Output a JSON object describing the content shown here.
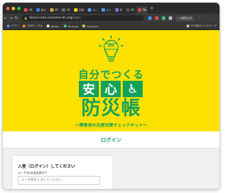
{
  "browser": {
    "tabs": [
      {
        "label": "AR",
        "color": "#e04a4a"
      },
      {
        "label": "安心",
        "color": "#3a7be0"
      },
      {
        "label": "AR",
        "color": "#e0a22a"
      },
      {
        "label": "AR",
        "color": "#6a6a6a"
      },
      {
        "label": "令和",
        "color": "#f0d020"
      },
      {
        "label": "ユー",
        "color": "#4a9ef0"
      },
      {
        "label": "ユー",
        "color": "#4a9ef0"
      },
      {
        "label": "作",
        "color": "#8a6ad0"
      },
      {
        "label": "AR",
        "color": "#555555"
      },
      {
        "label": "Rb",
        "color": "#d04a4a",
        "active": true
      }
    ],
    "add_tab": "+",
    "url": {
      "host": "bosai-note.inclusive-dn.org",
      "path": "/login"
    },
    "profile_label": "一時停止中",
    "bookmarks": [
      {
        "label": "アプリ",
        "color": "#5a8ae0"
      },
      {
        "label": "大学ポータル",
        "color": "#e08a3a"
      },
      {
        "label": "Notion",
        "color": "#dddddd"
      },
      {
        "label": "Portfolio",
        "color": "#4ac08a"
      },
      {
        "label": "Research",
        "color": "#e0c04a"
      }
    ],
    "bookmarks_right": "その他のブックマーク"
  },
  "hero": {
    "bulb_badge": "防災",
    "subtitle": "自分でつくる",
    "boxes": [
      "安",
      "心",
      "♿"
    ],
    "title": "防災帳",
    "tagline": "〜障害者の災害対策チェックキット〜",
    "colors": {
      "background": "#fde100",
      "green": "#13a25a"
    }
  },
  "login_tab": "ログイン",
  "login_card": {
    "heading": "入室（ログイン）してください",
    "field_label": "ユーザ名(半角英数字)",
    "required_mark": "*",
    "placeholder": "ユーザ名を入力してください"
  }
}
